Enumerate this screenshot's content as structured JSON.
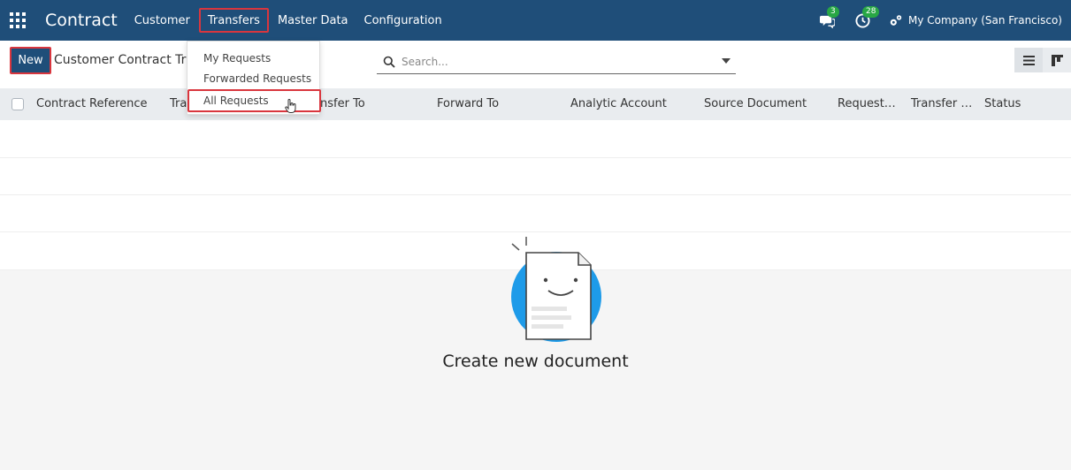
{
  "navbar": {
    "app_title": "Contract",
    "menu": [
      "Customer",
      "Transfers",
      "Master Data",
      "Configuration"
    ],
    "messages_count": "3",
    "activities_count": "28",
    "company": "My Company (San Francisco)"
  },
  "control_panel": {
    "new_label": "New",
    "breadcrumb": "Customer Contract Transfer",
    "search_placeholder": "Search..."
  },
  "transfers_menu": [
    "My Requests",
    "Forwarded Requests",
    "All Requests"
  ],
  "list": {
    "columns": [
      "Contract Reference",
      "Tra",
      "nsfer To",
      "Forward To",
      "Analytic Account",
      "Source Document",
      "Request…",
      "Transfer …",
      "Status"
    ]
  },
  "empty_state": {
    "title": "Create new document"
  },
  "colors": {
    "navbar": "#1f4e79",
    "highlight": "#d9363e",
    "badge": "#28a745",
    "accent": "#1e9be9"
  }
}
